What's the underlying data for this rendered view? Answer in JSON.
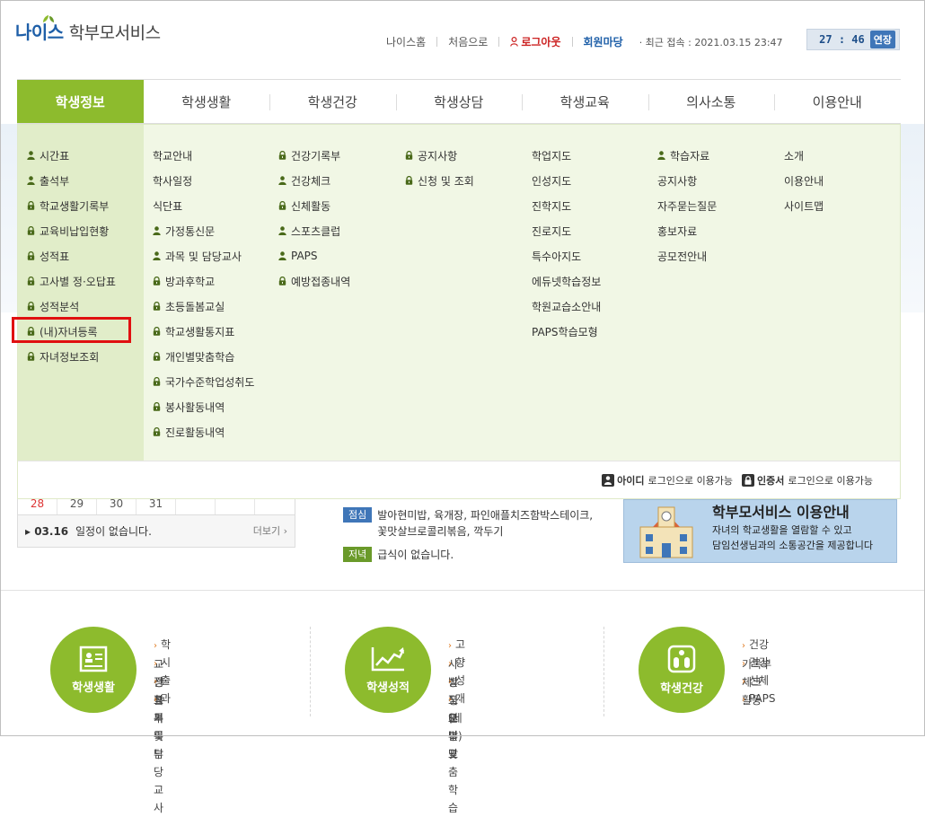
{
  "header": {
    "logo_neis": "나이스",
    "logo_title": "학부모서비스",
    "nav_home": "나이스홈",
    "nav_start": "처음으로",
    "nav_logout": "로그아웃",
    "nav_member": "회원마당",
    "recent_access": "· 최근 접속 : 2021.03.15 23:47",
    "timer": "27 : 46",
    "extend": "연장"
  },
  "gnb": [
    "학생정보",
    "학생생활",
    "학생건강",
    "학생상담",
    "학생교육",
    "의사소통",
    "이용안내"
  ],
  "mega": {
    "col1": [
      {
        "label": "시간표",
        "icon": "person-icon"
      },
      {
        "label": "출석부",
        "icon": "person-icon"
      },
      {
        "label": "학교생활기록부",
        "icon": "lock-icon"
      },
      {
        "label": "교육비납입현황",
        "icon": "lock-icon"
      },
      {
        "label": "성적표",
        "icon": "lock-icon"
      },
      {
        "label": "고사별 정·오답표",
        "icon": "lock-icon"
      },
      {
        "label": "성적분석",
        "icon": "lock-icon"
      },
      {
        "label": "(내)자녀등록",
        "icon": "lock-icon"
      },
      {
        "label": "자녀정보조회",
        "icon": "lock-icon"
      }
    ],
    "col2": [
      {
        "label": "학교안내",
        "icon": ""
      },
      {
        "label": "학사일정",
        "icon": ""
      },
      {
        "label": "식단표",
        "icon": ""
      },
      {
        "label": "가정통신문",
        "icon": "person-icon"
      },
      {
        "label": "과목 및 담당교사",
        "icon": "person-icon"
      },
      {
        "label": "방과후학교",
        "icon": "lock-icon"
      },
      {
        "label": "초등돌봄교실",
        "icon": "lock-icon"
      },
      {
        "label": "학교생활통지표",
        "icon": "lock-icon"
      },
      {
        "label": "개인별맞춤학습",
        "icon": "lock-icon"
      },
      {
        "label": "국가수준학업성취도",
        "icon": "lock-icon"
      },
      {
        "label": "봉사활동내역",
        "icon": "lock-icon"
      },
      {
        "label": "진로활동내역",
        "icon": "lock-icon"
      }
    ],
    "col3": [
      {
        "label": "건강기록부",
        "icon": "lock-icon"
      },
      {
        "label": "건강체크",
        "icon": "person-icon"
      },
      {
        "label": "신체활동",
        "icon": "lock-icon"
      },
      {
        "label": "스포츠클럽",
        "icon": "person-icon"
      },
      {
        "label": "PAPS",
        "icon": "person-icon"
      },
      {
        "label": "예방접종내역",
        "icon": "lock-icon"
      }
    ],
    "col4": [
      {
        "label": "공지사항",
        "icon": "lock-icon"
      },
      {
        "label": "신청 및 조회",
        "icon": "lock-icon"
      }
    ],
    "col5": [
      {
        "label": "학업지도",
        "icon": ""
      },
      {
        "label": "인성지도",
        "icon": ""
      },
      {
        "label": "진학지도",
        "icon": ""
      },
      {
        "label": "진로지도",
        "icon": ""
      },
      {
        "label": "특수아지도",
        "icon": ""
      },
      {
        "label": "에듀넷학습정보",
        "icon": ""
      },
      {
        "label": "학원교습소안내",
        "icon": ""
      },
      {
        "label": "PAPS학습모형",
        "icon": ""
      }
    ],
    "col6": [
      {
        "label": "학습자료",
        "icon": "person-icon"
      },
      {
        "label": "공지사항",
        "icon": ""
      },
      {
        "label": "자주묻는질문",
        "icon": ""
      },
      {
        "label": "홍보자료",
        "icon": ""
      },
      {
        "label": "공모전안내",
        "icon": ""
      }
    ],
    "col7": [
      {
        "label": "소개",
        "icon": ""
      },
      {
        "label": "이용안내",
        "icon": ""
      },
      {
        "label": "사이트맵",
        "icon": ""
      }
    ],
    "footer": {
      "id_badge": "아이디",
      "id_text": "로그인으로 이용가능",
      "cert_badge": "인증서",
      "cert_text": "로그인으로 이용가능"
    }
  },
  "calendar": {
    "days": [
      "28",
      "29",
      "30",
      "31",
      "",
      "",
      ""
    ],
    "date": "▸ 03.16",
    "note": "일정이 없습니다.",
    "more": "더보기 ›"
  },
  "meal": {
    "lunch_tag": "점심",
    "lunch": "발아현미밥, 육개장, 파인애플치즈함박스테이크, 꽃맛살브로콜리볶음, 깍두기",
    "dinner_tag": "저녁",
    "dinner": "급식이 없습니다."
  },
  "guide": {
    "title": "학부모서비스 이용안내",
    "desc1": "자녀의 학교생활을 열람할 수 있고",
    "desc2": "담임선생님과의 소통공간을 제공합니다"
  },
  "quick": [
    {
      "label": "학생생활",
      "icon": "id-card-icon",
      "items": [
        "학교생활기록부",
        "시간표",
        "출석부",
        "과목및담당교사"
      ]
    },
    {
      "label": "학생성적",
      "icon": "chart-up-icon",
      "items": [
        "고사별 정·오답표",
        "향상도(세부)",
        "성적표",
        "개인별맞춤학습"
      ]
    },
    {
      "label": "학생건강",
      "icon": "health-icon",
      "items": [
        "건강기록부",
        "건강체크",
        "신체활동",
        "PAPS"
      ]
    }
  ]
}
